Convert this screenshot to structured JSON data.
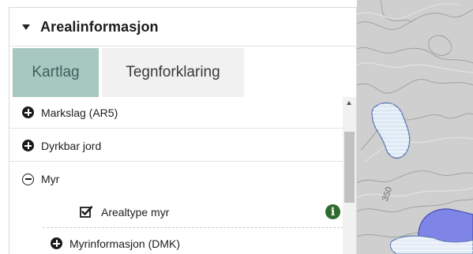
{
  "panel": {
    "title": "Arealinformasjon",
    "tabs": [
      {
        "label": "Kartlag",
        "active": true
      },
      {
        "label": "Tegnforklaring",
        "active": false
      }
    ]
  },
  "layers": {
    "items": [
      {
        "label": "Markslag (AR5)",
        "state": "collapsed"
      },
      {
        "label": "Dyrkbar jord",
        "state": "collapsed"
      },
      {
        "label": "Myr",
        "state": "expanded"
      }
    ],
    "children": [
      {
        "label": "Arealtype myr",
        "checked": true,
        "has_info": true,
        "info_icon": "info-icon"
      },
      {
        "label": "Myrinformasjon (DMK)",
        "state": "collapsed"
      }
    ]
  },
  "map": {
    "contour_label": "350"
  },
  "colors": {
    "tab_active_bg": "#a7c8c1",
    "tab_active_text": "#3e5f59",
    "tab_inactive_bg": "#f1f1f1",
    "info_icon": "#2f6b2f",
    "map_background": "#cfcfcf",
    "map_polygon_light": "#dde8f5",
    "map_polygon_dark": "#7f85e6"
  }
}
